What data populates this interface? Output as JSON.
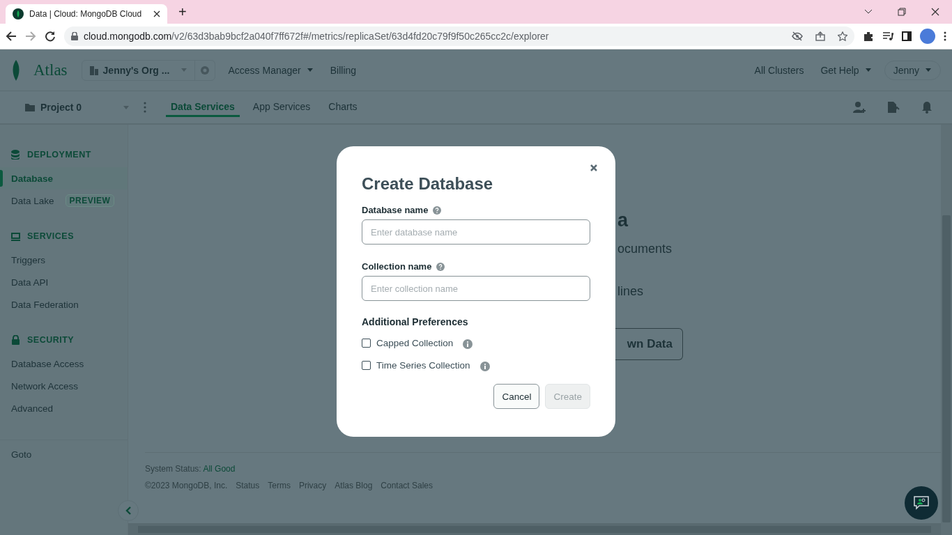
{
  "browser": {
    "tab_title": "Data | Cloud: MongoDB Cloud",
    "new_tab": "+",
    "url_host": "cloud.mongodb.com",
    "url_path": "/v2/63d3bab9bcf2a040f7ff672f#/metrics/replicaSet/63d4fd20c79f9f50c265cc2c/explorer"
  },
  "header": {
    "logo": "Atlas",
    "org": "Jenny's Org ...",
    "nav": [
      {
        "label": "Access Manager",
        "dropdown": true
      },
      {
        "label": "Billing",
        "dropdown": false
      }
    ],
    "right": [
      {
        "label": "All Clusters",
        "dropdown": false,
        "outlined": false
      },
      {
        "label": "Get Help",
        "dropdown": true,
        "outlined": false
      },
      {
        "label": "Jenny",
        "dropdown": true,
        "outlined": true
      }
    ]
  },
  "subnav": {
    "project": "Project 0",
    "tabs": [
      {
        "label": "Data Services",
        "selected": true
      },
      {
        "label": "App Services",
        "selected": false
      },
      {
        "label": "Charts",
        "selected": false
      }
    ]
  },
  "sidebar": {
    "sections": [
      {
        "title": "DEPLOYMENT",
        "items": [
          {
            "label": "Database",
            "selected": true
          },
          {
            "label": "Data Lake",
            "selected": false,
            "badge": "PREVIEW"
          }
        ]
      },
      {
        "title": "SERVICES",
        "items": [
          {
            "label": "Triggers",
            "selected": false
          },
          {
            "label": "Data API",
            "selected": false
          },
          {
            "label": "Data Federation",
            "selected": false
          }
        ]
      },
      {
        "title": "SECURITY",
        "items": [
          {
            "label": "Database Access",
            "selected": false
          },
          {
            "label": "Network Access",
            "selected": false
          },
          {
            "label": "Advanced",
            "selected": false
          }
        ]
      }
    ],
    "goto": "Goto"
  },
  "backdrop": {
    "heading_part": "a",
    "line_1_part": "ocuments",
    "line_2_part": "lines",
    "button_part": "wn Data"
  },
  "footer": {
    "status_label": "System Status:",
    "status_value": "All Good",
    "copyright": "©2023 MongoDB, Inc.",
    "links": [
      "Status",
      "Terms",
      "Privacy",
      "Atlas Blog",
      "Contact Sales"
    ]
  },
  "modal": {
    "title": "Create Database",
    "fields": [
      {
        "label": "Database name",
        "placeholder": "Enter database name"
      },
      {
        "label": "Collection name",
        "placeholder": "Enter collection name"
      }
    ],
    "preferences_title": "Additional Preferences",
    "options": [
      {
        "label": "Capped Collection",
        "checked": false
      },
      {
        "label": "Time Series Collection",
        "checked": false
      }
    ],
    "buttons": [
      {
        "label": "Cancel",
        "disabled": false
      },
      {
        "label": "Create",
        "disabled": true
      }
    ]
  }
}
